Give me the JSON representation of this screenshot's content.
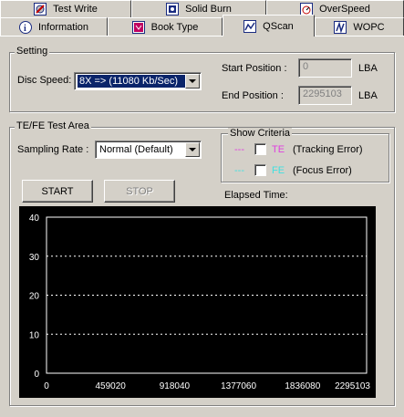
{
  "tabs_row1": [
    {
      "label": "Test Write",
      "icon": "test-write-icon"
    },
    {
      "label": "Solid Burn",
      "icon": "solid-burn-icon"
    },
    {
      "label": "OverSpeed",
      "icon": "overspeed-icon"
    }
  ],
  "tabs_row2": [
    {
      "label": "Information",
      "icon": "information-icon"
    },
    {
      "label": "Book Type",
      "icon": "book-type-icon"
    },
    {
      "label": "QScan",
      "icon": "qscan-icon",
      "active": true
    },
    {
      "label": "WOPC",
      "icon": "wopc-icon"
    }
  ],
  "setting": {
    "title": "Setting",
    "disc_speed_label": "Disc Speed:",
    "disc_speed_value": "8X => (11080 Kb/Sec)",
    "start_position_label": "Start Position :",
    "start_position_value": "0",
    "end_position_label": "End Position :",
    "end_position_value": "2295103",
    "unit": "LBA"
  },
  "test_area": {
    "title": "TE/FE Test Area",
    "sampling_rate_label": "Sampling Rate :",
    "sampling_rate_value": "Normal (Default)",
    "show_criteria": {
      "title": "Show Criteria",
      "te": {
        "marker": "---",
        "code": "TE",
        "desc": "(Tracking Error)",
        "checked": false,
        "color": "#e040e0"
      },
      "fe": {
        "marker": "---",
        "code": "FE",
        "desc": "(Focus Error)",
        "checked": false,
        "color": "#40e0e0"
      }
    },
    "start_button": "START",
    "stop_button": "STOP",
    "elapsed_label": "Elapsed Time:"
  },
  "chart_data": {
    "type": "line",
    "title": "",
    "xlabel": "",
    "ylabel": "",
    "x_ticks": [
      "0",
      "459020",
      "918040",
      "1377060",
      "1836080",
      "2295103"
    ],
    "y_ticks": [
      "0",
      "10",
      "20",
      "30",
      "40"
    ],
    "xlim": [
      0,
      2295103
    ],
    "ylim": [
      0,
      40
    ],
    "gridlines_y": [
      10,
      20,
      30
    ],
    "series": [],
    "colors": {
      "background": "#000000",
      "axis": "#ffffff",
      "grid": "#ffffff"
    }
  }
}
